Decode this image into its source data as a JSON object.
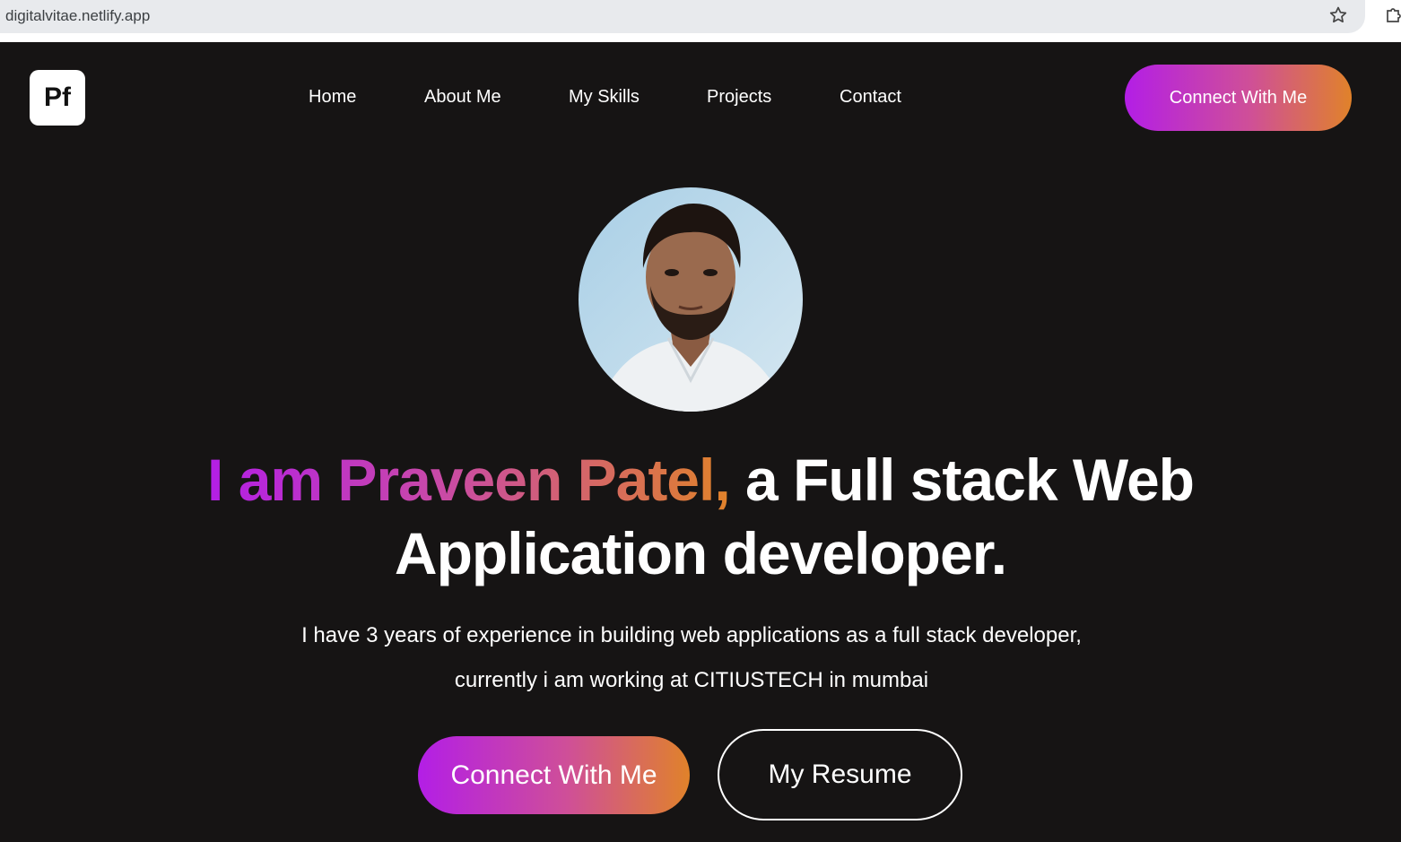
{
  "browser": {
    "url": "digitalvitae.netlify.app",
    "bookmark_icon": "star-icon",
    "extensions_icon": "puzzle-icon"
  },
  "header": {
    "logo_text": "Pf",
    "nav": [
      {
        "label": "Home"
      },
      {
        "label": "About Me"
      },
      {
        "label": "My Skills"
      },
      {
        "label": "Projects"
      },
      {
        "label": "Contact"
      }
    ],
    "cta_label": "Connect With Me"
  },
  "hero": {
    "avatar_alt": "profile-photo",
    "headline_gradient": "I am Praveen Patel,",
    "headline_rest": "a Full stack Web",
    "headline_line2": "Application developer.",
    "description_line1": "I have 3 years of experience in building web applications as a full stack developer,",
    "description_line2": "currently i am working at CITIUSTECH in mumbai",
    "primary_button": "Connect With Me",
    "secondary_button": "My Resume"
  },
  "colors": {
    "background": "#161414",
    "gradient_start": "#b31ee6",
    "gradient_end": "#e0822a",
    "text": "#ffffff"
  }
}
